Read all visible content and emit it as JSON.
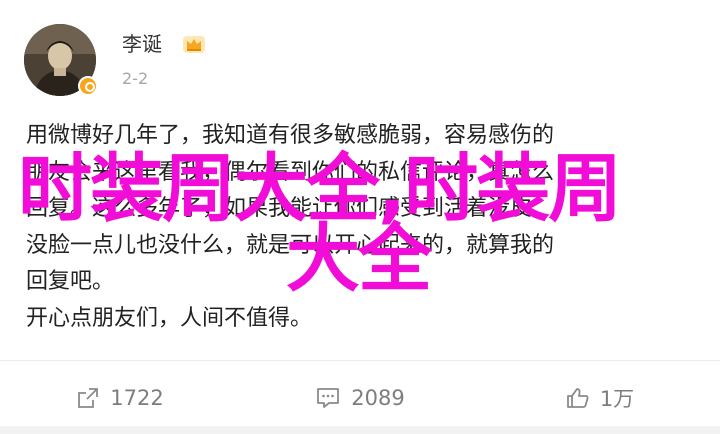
{
  "post": {
    "author": {
      "name": "李诞",
      "avatar_icon": "avatar-portrait",
      "badge_icon": "crown-icon",
      "verified_icon": "verified-badge-icon",
      "verified_color": "#f7a51b"
    },
    "time": "2-2",
    "content_lines": [
      "用微博好几年了，我知道有很多敏感脆弱，容易感伤的",
      "朋友会来这里看我，偶尔看到你们的私信评论，真怎么",
      "回复。这么多年了，如果我能让你们感受到活着没皮",
      "没脸一点儿也没什么，就是可以开心起来的，就算我的",
      "回复吧。",
      "开心点朋友们，人间不值得。"
    ],
    "overlay": {
      "line1": "时装周大全,时装周",
      "line2": "大全",
      "color": "#f20cd8"
    }
  },
  "actions": {
    "repost": {
      "icon": "repost-icon",
      "count": "1722"
    },
    "comment": {
      "icon": "comment-icon",
      "count": "2089"
    },
    "like": {
      "icon": "thumbs-up-icon",
      "count": "1万"
    }
  }
}
